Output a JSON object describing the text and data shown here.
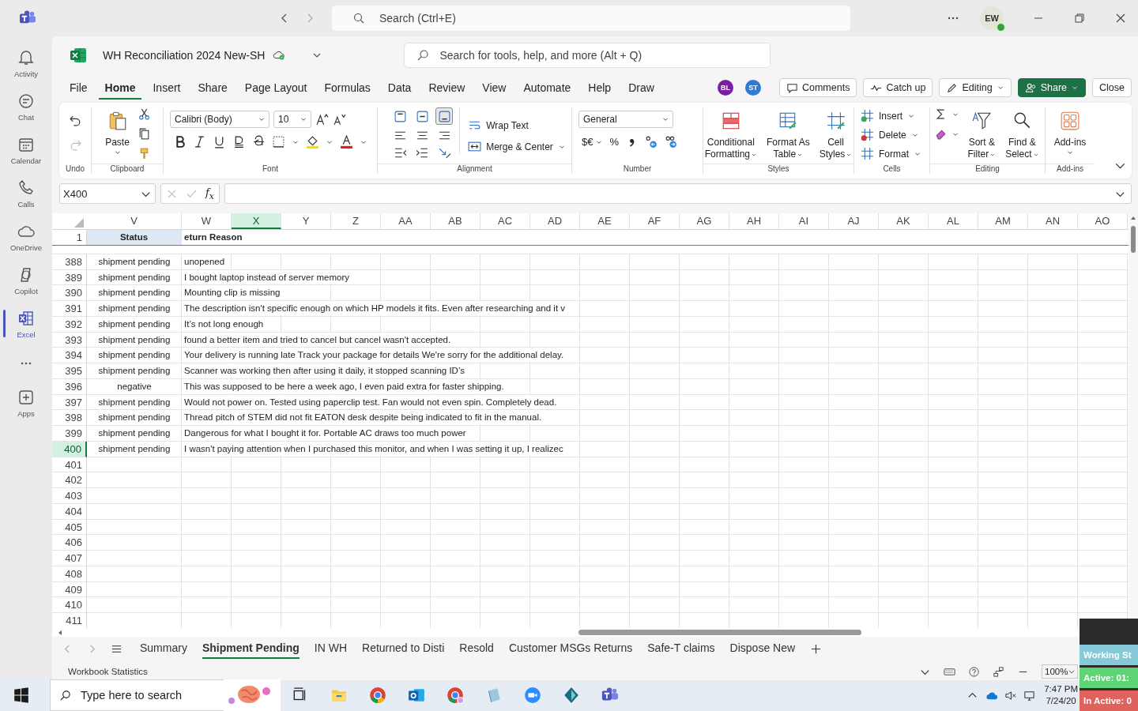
{
  "app_bar": {
    "search": {
      "placeholder": "Search (Ctrl+E)"
    },
    "avatar": "EW"
  },
  "rail": [
    {
      "label": "Activity",
      "selected": false
    },
    {
      "label": "Chat",
      "selected": false
    },
    {
      "label": "Calendar",
      "selected": false
    },
    {
      "label": "Calls",
      "selected": false
    },
    {
      "label": "OneDrive",
      "selected": false
    },
    {
      "label": "Copilot",
      "selected": false
    },
    {
      "label": "Excel",
      "selected": true
    },
    {
      "label": "Apps",
      "selected": false
    }
  ],
  "workbook": {
    "title": "WH Reconciliation 2024 New-SH",
    "search": {
      "placeholder": "Search for tools, help, and more (Alt + Q)"
    }
  },
  "menu": {
    "tabs": [
      {
        "label": "File",
        "selected": false
      },
      {
        "label": "Home",
        "selected": true
      },
      {
        "label": "Insert",
        "selected": false
      },
      {
        "label": "Share",
        "selected": false
      },
      {
        "label": "Page Layout",
        "selected": false
      },
      {
        "label": "Formulas",
        "selected": false
      },
      {
        "label": "Data",
        "selected": false
      },
      {
        "label": "Review",
        "selected": false
      },
      {
        "label": "View",
        "selected": false
      },
      {
        "label": "Automate",
        "selected": false
      },
      {
        "label": "Help",
        "selected": false
      },
      {
        "label": "Draw",
        "selected": false
      }
    ],
    "collaborators": [
      {
        "initials": "BL",
        "color": "#7a1fa2"
      },
      {
        "initials": "ST",
        "color": "#2f7ad6"
      }
    ],
    "comments": "Comments",
    "catch_up": "Catch up",
    "editing": "Editing",
    "share": "Share",
    "close": "Close"
  },
  "ribbon": {
    "undo": {
      "label": "Undo",
      "redo": {
        "disabled": true
      }
    },
    "clipboard": {
      "label": "Clipboard",
      "paste": "Paste"
    },
    "font": {
      "label": "Font",
      "family": "Calibri (Body)",
      "size": "10"
    },
    "alignment": {
      "label": "Alignment",
      "wrap_text": "Wrap Text",
      "merge": "Merge & Center",
      "vertical_align": [
        {
          "selected": false
        },
        {
          "selected": false
        },
        {
          "selected": true
        }
      ]
    },
    "number": {
      "label": "Number",
      "format": "General",
      "currency": "$€",
      "percent": "%"
    },
    "styles": {
      "label": "Styles",
      "buttons": [
        {
          "lines": [
            "Conditional",
            "Formatting"
          ]
        },
        {
          "lines": [
            "Format As",
            "Table"
          ]
        },
        {
          "lines": [
            "Cell",
            "Styles"
          ]
        }
      ]
    },
    "cells": {
      "label": "Cells",
      "buttons": [
        "Insert",
        "Delete",
        "Format"
      ]
    },
    "editing": {
      "label": "Editing",
      "buttons": [
        {
          "lines": [
            "Sort &",
            "Filter"
          ]
        },
        {
          "lines": [
            "Find &",
            "Select"
          ]
        }
      ]
    },
    "addins": {
      "label": "Add-ins",
      "button": "Add-ins"
    }
  },
  "formula_bar": {
    "name_box": "X400",
    "function": "f$_{x}$"
  },
  "sheet": {
    "columns": [
      {
        "label": "V",
        "selected": false
      },
      {
        "label": "W",
        "selected": false
      },
      {
        "label": "X",
        "selected": true
      },
      {
        "label": "Y",
        "selected": false
      },
      {
        "label": "Z",
        "selected": false
      },
      {
        "label": "AA",
        "selected": false
      },
      {
        "label": "AB",
        "selected": false
      },
      {
        "label": "AC",
        "selected": false
      },
      {
        "label": "AD",
        "selected": false
      },
      {
        "label": "AE",
        "selected": false
      },
      {
        "label": "AF",
        "selected": false
      },
      {
        "label": "AG",
        "selected": false
      },
      {
        "label": "AH",
        "selected": false
      },
      {
        "label": "AI",
        "selected": false
      },
      {
        "label": "AJ",
        "selected": false
      },
      {
        "label": "AK",
        "selected": false
      },
      {
        "label": "AL",
        "selected": false
      },
      {
        "label": "AM",
        "selected": false
      },
      {
        "label": "AN",
        "selected": false
      },
      {
        "label": "AO",
        "selected": false
      }
    ],
    "header_row": {
      "number": "1",
      "status": "Status",
      "reason": "eturn Reason"
    },
    "rows": [
      {
        "number": "388",
        "status": "shipment pending",
        "reason": "unopened",
        "selected": false
      },
      {
        "number": "389",
        "status": "shipment pending",
        "reason": "I bought laptop instead of server memory",
        "selected": false
      },
      {
        "number": "390",
        "status": "shipment pending",
        "reason": "Mounting clip is missing",
        "selected": false
      },
      {
        "number": "391",
        "status": "shipment pending",
        "reason": "The description isn't specific enough on which HP models it fits. Even after researching and it v",
        "selected": false
      },
      {
        "number": "392",
        "status": "shipment pending",
        "reason": "It’s not long enough",
        "selected": false
      },
      {
        "number": "393",
        "status": "shipment pending",
        "reason": "found a better item and tried to cancel but cancel wasn't accepted.",
        "selected": false
      },
      {
        "number": "394",
        "status": "shipment pending",
        "reason": "Your delivery is running late Track your package for details We're sorry for the additional delay.",
        "selected": false
      },
      {
        "number": "395",
        "status": "shipment pending",
        "reason": "Scanner was working then after using it daily, it stopped scanning ID’s",
        "selected": false
      },
      {
        "number": "396",
        "status": "negative",
        "reason": "This was supposed to be here a week ago, I even paid extra for faster shipping.",
        "selected": false
      },
      {
        "number": "397",
        "status": "shipment pending",
        "reason": "Would not power on. Tested using paperclip test. Fan would not even spin. Completely dead.",
        "selected": false
      },
      {
        "number": "398",
        "status": "shipment pending",
        "reason": "Thread pitch of STEM did not fit EATON desk despite being indicated to fit in the manual.",
        "selected": false
      },
      {
        "number": "399",
        "status": "shipment pending",
        "reason": "Dangerous for what I bought it for. Portable AC draws too much power",
        "selected": false
      },
      {
        "number": "400",
        "status": "shipment pending",
        "reason": "I wasn't paying attention when I purchased this monitor, and when I was setting it up, I realizec",
        "selected": true
      },
      {
        "number": "401",
        "selected": false
      },
      {
        "number": "402",
        "selected": false
      },
      {
        "number": "403",
        "selected": false
      },
      {
        "number": "404",
        "selected": false
      },
      {
        "number": "405",
        "selected": false
      },
      {
        "number": "406",
        "selected": false
      },
      {
        "number": "407",
        "selected": false
      },
      {
        "number": "408",
        "selected": false
      },
      {
        "number": "409",
        "selected": false
      },
      {
        "number": "410",
        "selected": false
      },
      {
        "number": "411",
        "selected": false
      }
    ]
  },
  "sheet_tabs": [
    {
      "label": "Summary",
      "selected": false
    },
    {
      "label": "Shipment Pending",
      "selected": true
    },
    {
      "label": "IN WH",
      "selected": false
    },
    {
      "label": "Returned to Disti",
      "selected": false
    },
    {
      "label": "Resold",
      "selected": false
    },
    {
      "label": "Customer MSGs Returns",
      "selected": false
    },
    {
      "label": "Safe-T claims",
      "selected": false
    },
    {
      "label": "Dispose New",
      "selected": false
    }
  ],
  "status_bar": {
    "label": "Workbook Statistics",
    "zoom": "100%"
  },
  "taskbar": {
    "search": {
      "placeholder": "Type here to search"
    },
    "time": "7:47 PM",
    "date": "7/24/20"
  },
  "tracker": {
    "rows": [
      {
        "text": "Working St",
        "color": "#86c9d8"
      },
      {
        "text": "Active: 01:",
        "color": "#5fd474"
      },
      {
        "text": "In Active: 0",
        "color": "#e0625c"
      }
    ]
  }
}
